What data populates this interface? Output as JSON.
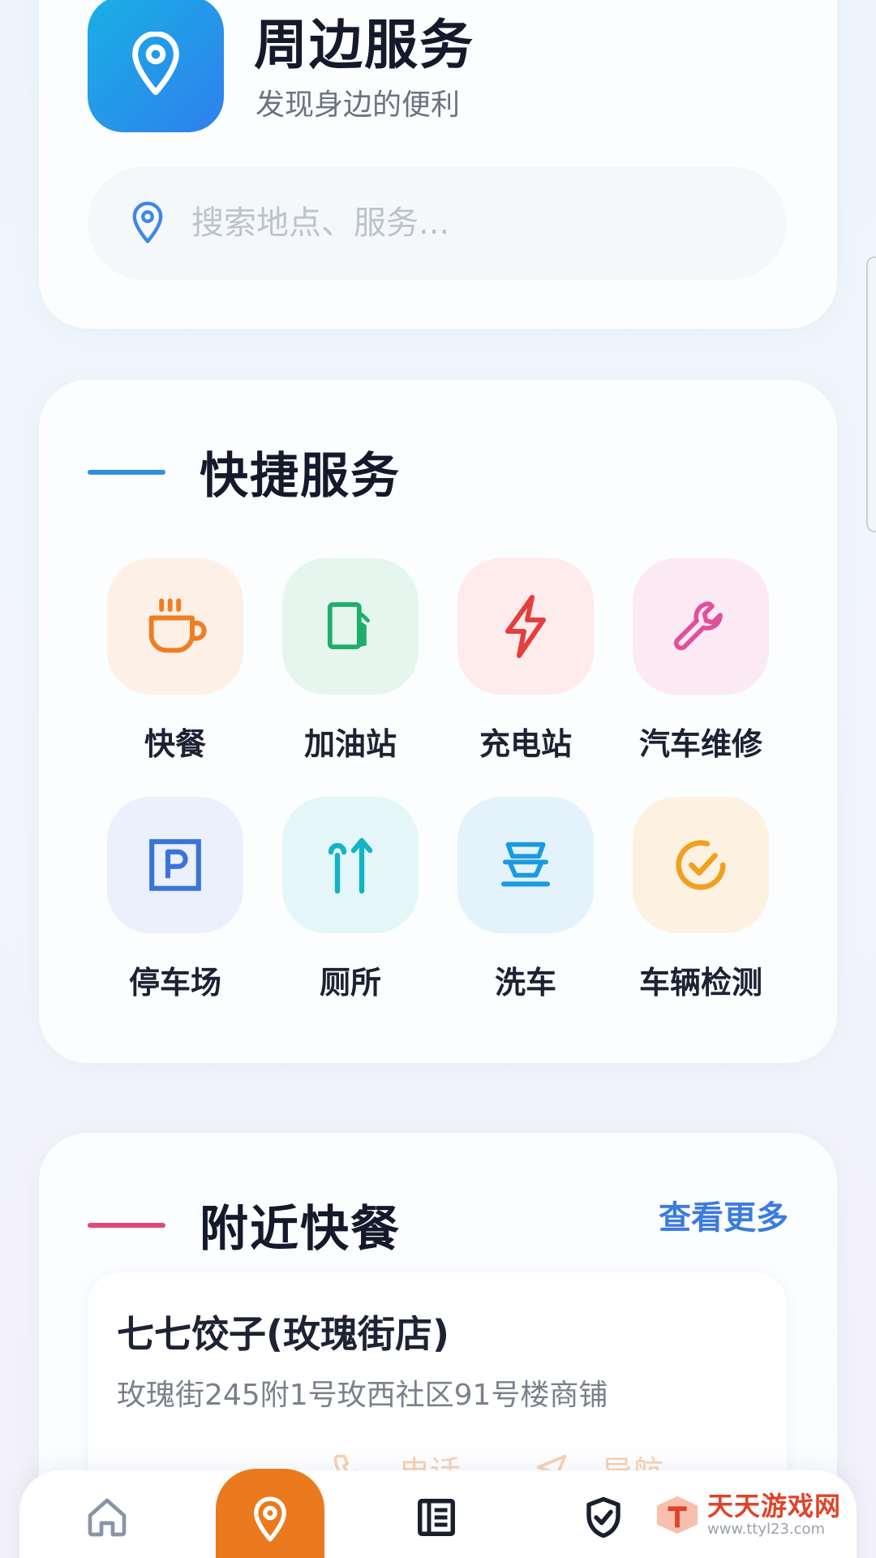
{
  "header": {
    "title": "周边服务",
    "subtitle": "发现身边的便利",
    "icon": "location-pin-icon"
  },
  "search": {
    "placeholder": "搜索地点、服务...",
    "value": "",
    "icon": "location-pin-icon"
  },
  "quick": {
    "title": "快捷服务",
    "accent": "#2f8fe0",
    "items": [
      {
        "label": "快餐",
        "icon": "coffee-cup-icon",
        "color": "#ef7d22",
        "bg": "#fdf0e6"
      },
      {
        "label": "加油站",
        "icon": "fuel-pump-icon",
        "color": "#1fae6a",
        "bg": "#e6f6ee"
      },
      {
        "label": "充电站",
        "icon": "lightning-bolt-icon",
        "color": "#e53e3e",
        "bg": "#fdeceb"
      },
      {
        "label": "汽车维修",
        "icon": "wrench-icon",
        "color": "#e0509a",
        "bg": "#fbe9f3"
      },
      {
        "label": "停车场",
        "icon": "parking-icon",
        "color": "#3b74d8",
        "bg": "#eaf0fc"
      },
      {
        "label": "厕所",
        "icon": "restroom-icon",
        "color": "#14b3c4",
        "bg": "#e4f6f8"
      },
      {
        "label": "洗车",
        "icon": "car-wash-icon",
        "color": "#1a9be0",
        "bg": "#e4f2fb"
      },
      {
        "label": "车辆检测",
        "icon": "check-circle-icon",
        "color": "#f0a020",
        "bg": "#fdf2e2"
      }
    ]
  },
  "nearby": {
    "title": "附近快餐",
    "accent": "#e0487a",
    "more_label": "查看更多",
    "shops": [
      {
        "name": "七七饺子(玫瑰街店)",
        "address": "玫瑰街245附1号玫西社区91号楼商铺",
        "call_label": "电话",
        "nav_label": "导航"
      }
    ]
  },
  "bottom_nav": {
    "items": [
      {
        "icon": "home-icon"
      },
      {
        "icon": "location-pin-icon",
        "active": true
      },
      {
        "icon": "list-icon"
      },
      {
        "icon": "shield-check-icon"
      }
    ],
    "active_color": "#ea7a1d"
  },
  "watermark": {
    "title": "天天游戏网",
    "url": "www.ttyl23.com"
  }
}
